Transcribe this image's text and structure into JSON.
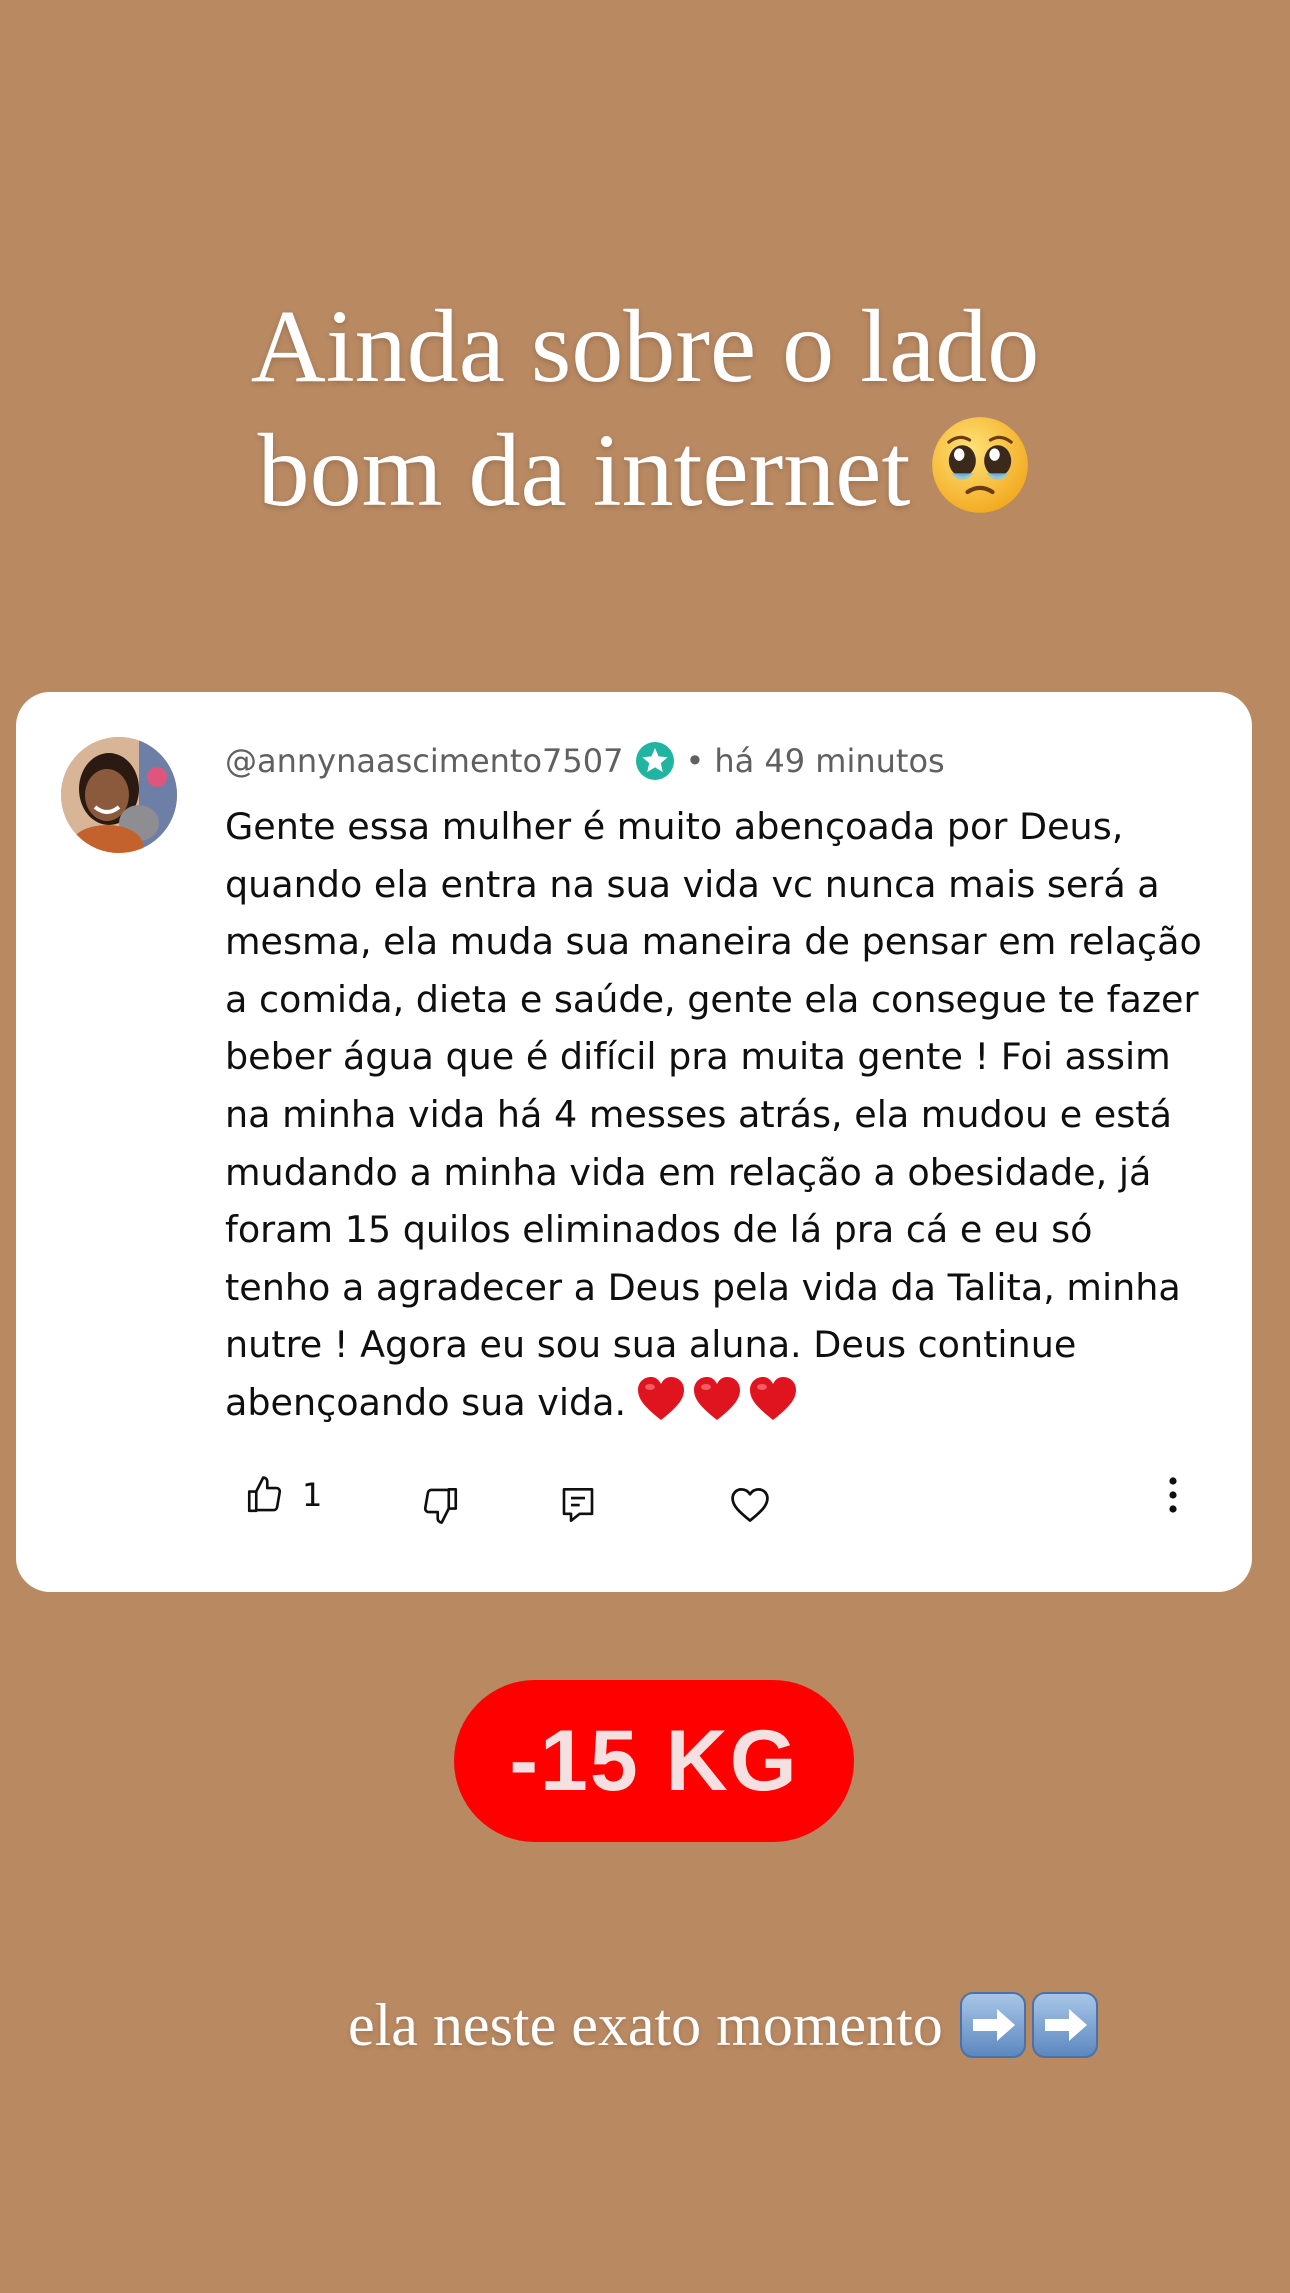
{
  "story": {
    "headline_line1": "Ainda sobre o lado",
    "headline_line2": "bom da internet",
    "headline_emoji": "pleading-face-emoji"
  },
  "comment": {
    "username": "@annynaascimento7507",
    "verified_badge": "star-verified-icon",
    "separator": "•",
    "timestamp": "há 49 minutos",
    "lines": [
      "Gente essa mulher é muito abençoada por Deus,",
      "quando ela entra na sua vida vc nunca mais será a",
      "mesma, ela muda sua maneira de pensar em relação",
      "a comida, dieta e saúde, gente ela consegue te fazer",
      "beber água que é difícil pra muita gente ! Foi assim",
      "na minha vida há 4 messes atrás, ela mudou e está",
      "mudando a minha vida em relação a obesidade, já",
      "foram 15 quilos eliminados de lá pra cá e eu só",
      "tenho a agradecer a Deus pela vida da Talita, minha",
      "nutre !  Agora eu sou sua aluna. Deus continue",
      "abençoando sua vida."
    ],
    "trailing_emojis": [
      "red-heart-emoji",
      "red-heart-emoji",
      "red-heart-emoji"
    ],
    "like_count": "1",
    "actions": [
      "thumbs-up-icon",
      "thumbs-down-icon",
      "reply-icon",
      "heart-icon",
      "more-vertical-icon"
    ]
  },
  "badge": {
    "text": "-15 KG",
    "color": "#ff0000"
  },
  "caption": {
    "text": "ela neste exato momento",
    "emojis": [
      "right-arrow-emoji",
      "right-arrow-emoji"
    ]
  },
  "colors": {
    "background": "#b98962",
    "card": "#ffffff",
    "verified": "#1fb5a0"
  }
}
